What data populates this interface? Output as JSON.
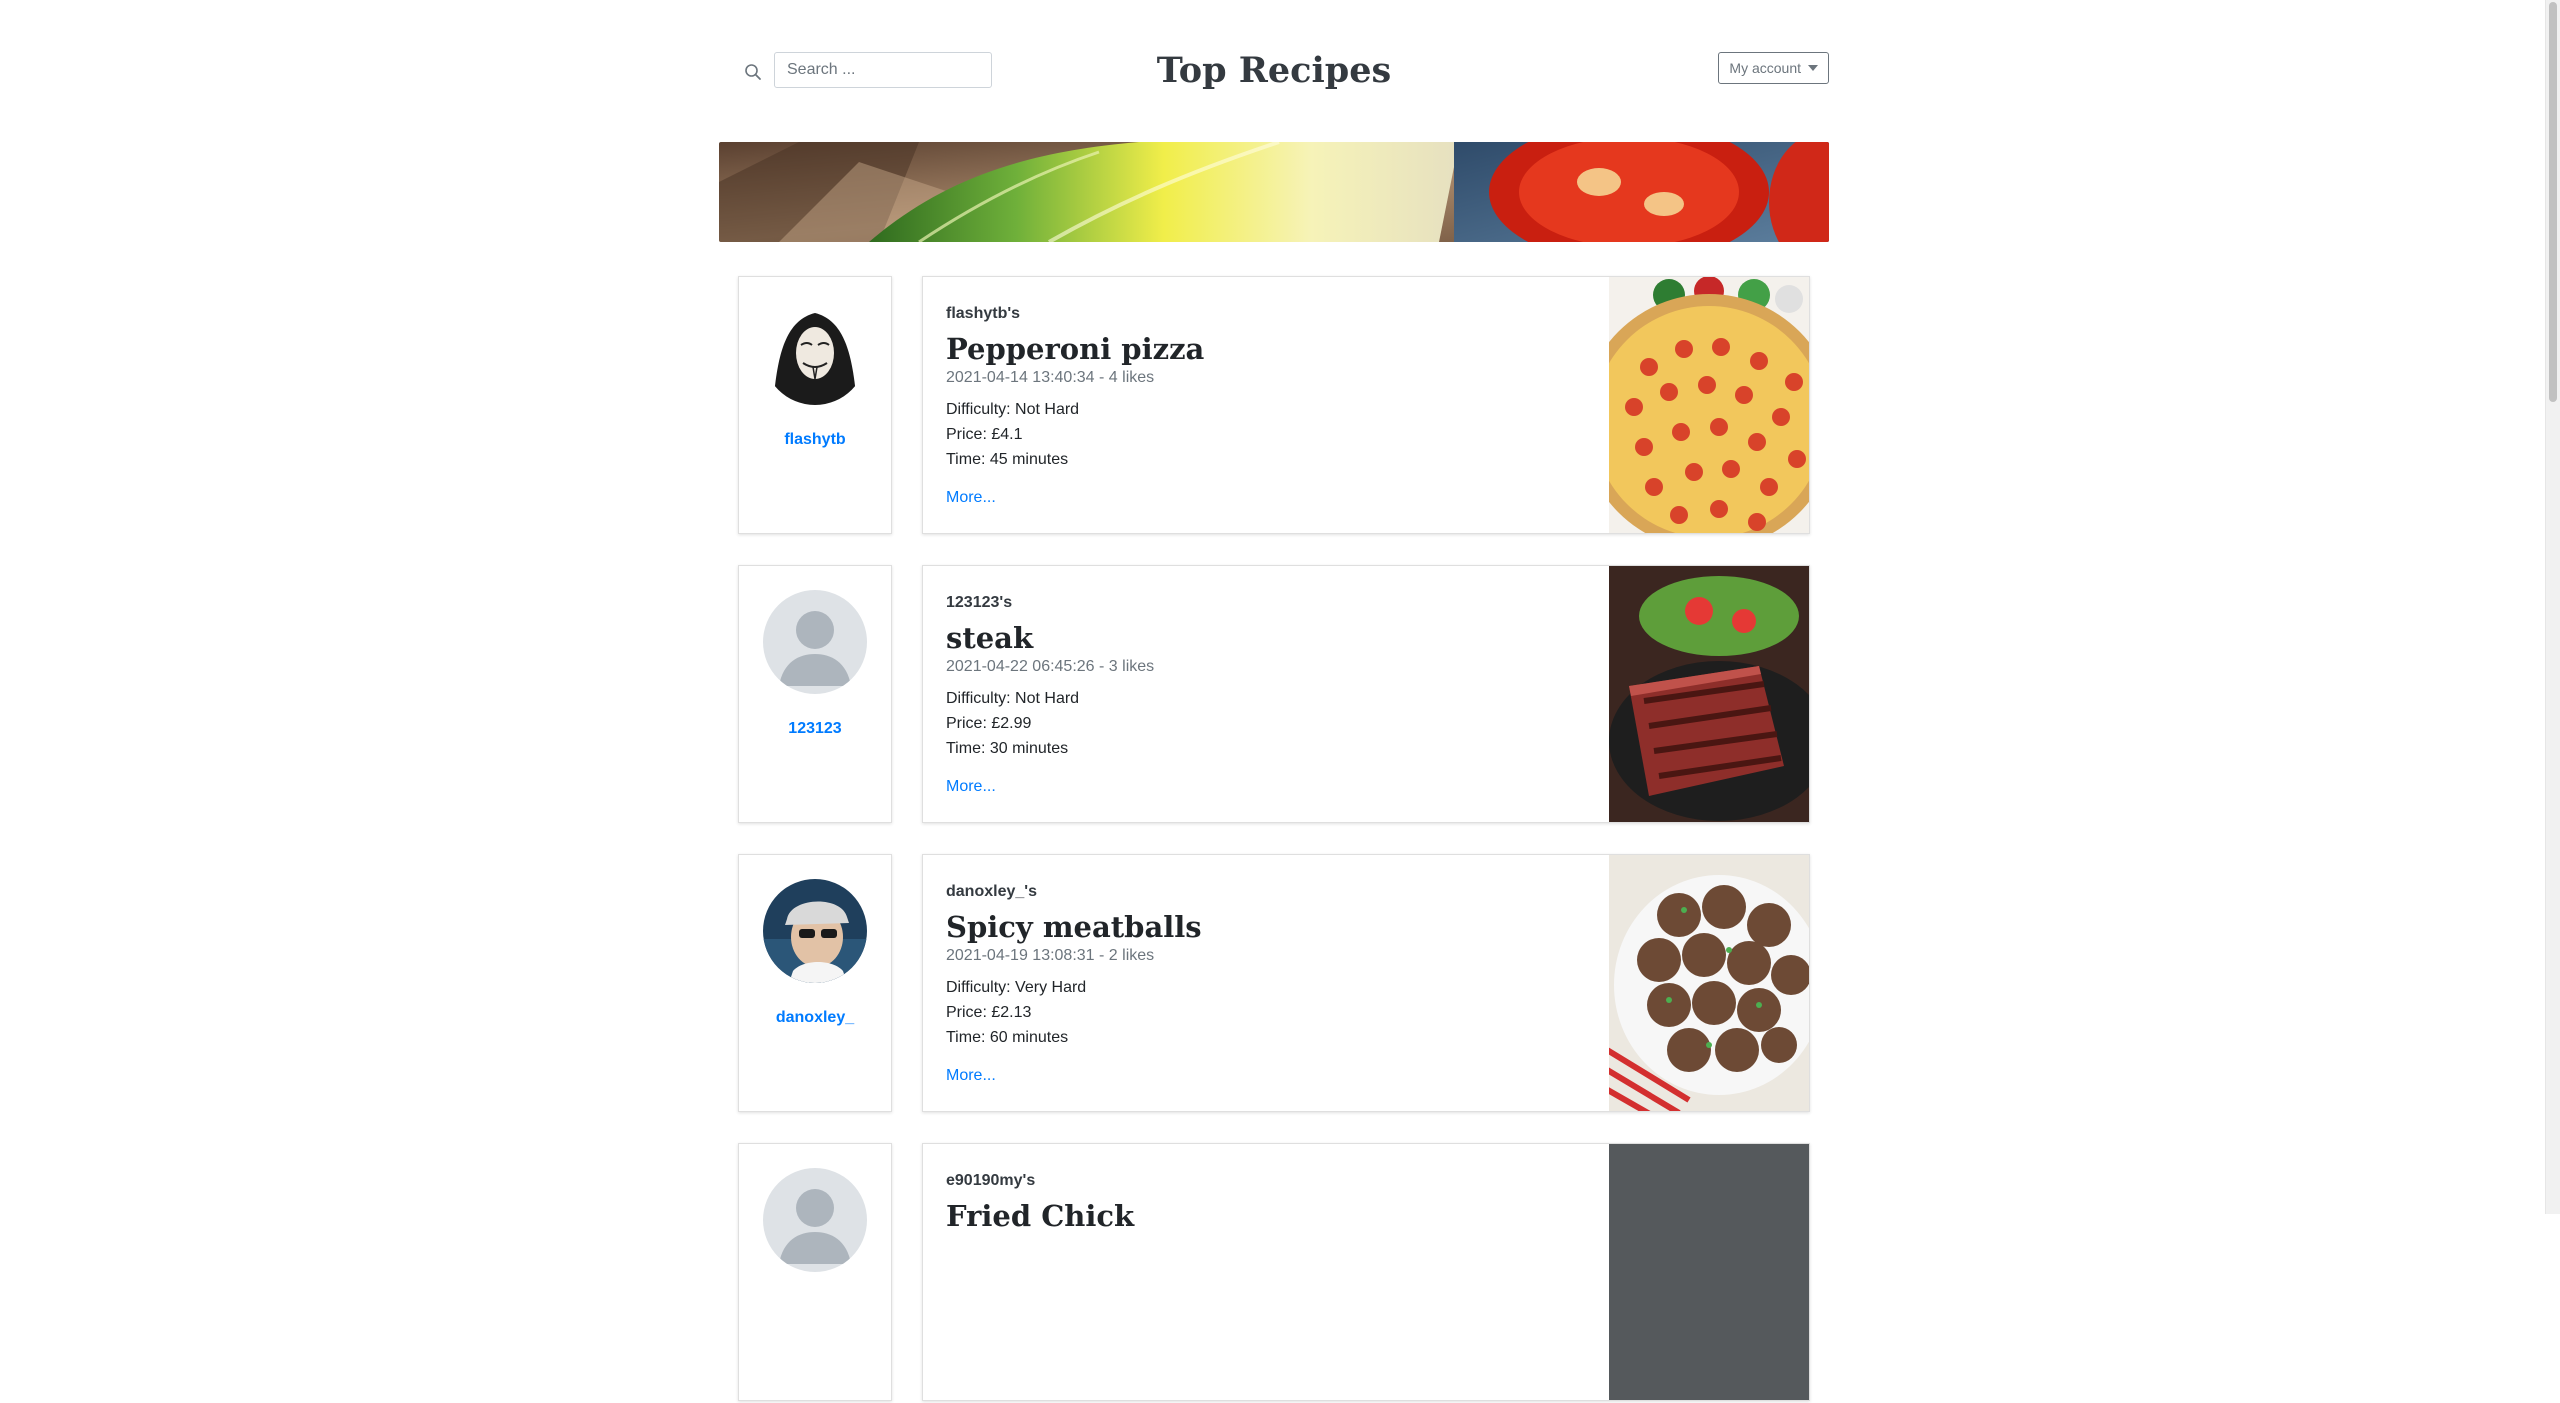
{
  "header": {
    "title": "Top Recipes",
    "search_placeholder": "Search ...",
    "search_value": "",
    "account_label": "My account"
  },
  "recipes": [
    {
      "author": "flashytb",
      "owner_label": "flashytb's",
      "title": "Pepperoni pizza",
      "meta": "2021-04-14 13:40:34 - 4 likes",
      "difficulty": "Difficulty: Not Hard",
      "price": "Price: £4.1",
      "time": "Time: 45 minutes",
      "more": "More..."
    },
    {
      "author": "123123",
      "owner_label": "123123's",
      "title": "steak",
      "meta": "2021-04-22 06:45:26 - 3 likes",
      "difficulty": "Difficulty: Not Hard",
      "price": "Price: £2.99",
      "time": "Time: 30 minutes",
      "more": "More..."
    },
    {
      "author": "danoxley_",
      "owner_label": "danoxley_'s",
      "title": "Spicy meatballs",
      "meta": "2021-04-19 13:08:31 - 2 likes",
      "difficulty": "Difficulty: Very Hard",
      "price": "Price: £2.13",
      "time": "Time: 60 minutes",
      "more": "More..."
    },
    {
      "author": "",
      "owner_label": "e90190my's",
      "title": "Fried Chick",
      "meta": "",
      "difficulty": "",
      "price": "",
      "time": "",
      "more": ""
    }
  ],
  "colors": {
    "link": "#007bff",
    "title": "#343a40",
    "muted": "#6c757d"
  }
}
